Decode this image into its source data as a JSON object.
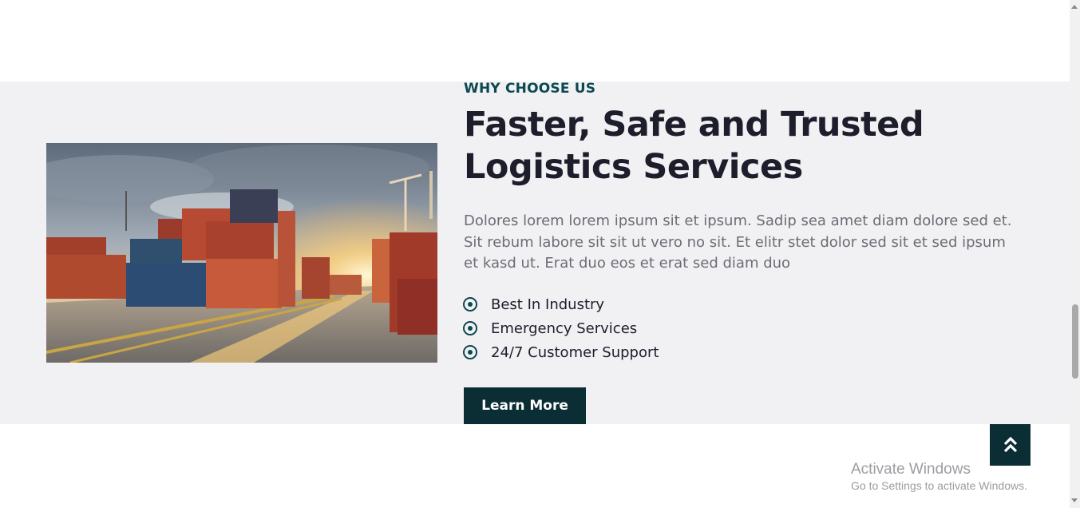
{
  "about": {
    "eyebrow": "WHY CHOOSE US",
    "title_line1": "Faster, Safe and Trusted",
    "title_line2": "Logistics Services",
    "description": "Dolores lorem lorem ipsum sit et ipsum. Sadip sea amet diam dolore sed et. Sit rebum labore sit sit ut vero no sit. Et elitr stet dolor sed sit et sed ipsum et kasd ut. Erat duo eos et erat sed diam duo",
    "features": [
      {
        "label": "Best In Industry",
        "icon": "radio-circle-icon"
      },
      {
        "label": "Emergency Services",
        "icon": "radio-circle-icon"
      },
      {
        "label": "24/7 Customer Support",
        "icon": "radio-circle-icon"
      }
    ],
    "cta_label": "Learn More"
  },
  "back_to_top": {
    "icon": "double-chevron-up-icon"
  },
  "watermark": {
    "title": "Activate Windows",
    "subtitle": "Go to Settings to activate Windows."
  },
  "colors": {
    "accent": "#0b4950",
    "button_bg": "#0b2e35",
    "heading": "#1d1d2c",
    "section_bg": "#f1f1f3"
  }
}
